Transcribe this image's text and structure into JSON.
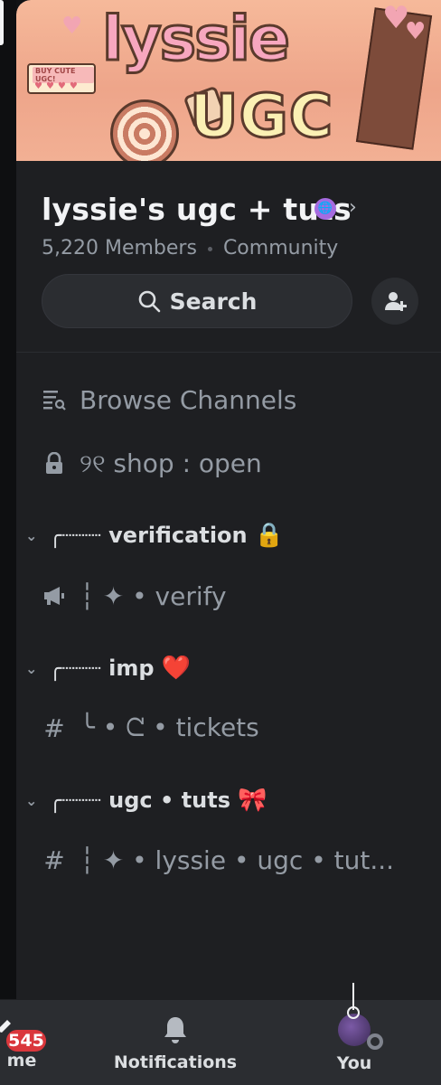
{
  "banner": {
    "title": "lyssie",
    "subtitle": "UGC",
    "tag": "BUY CUTE UGC!"
  },
  "server": {
    "name": "lyssie's ugc + tuts",
    "members": "5,220 Members",
    "type": "Community"
  },
  "search": {
    "label": "Search"
  },
  "channels": {
    "browse": "Browse Channels",
    "shop": "୨୧ shop : open",
    "categories": [
      {
        "label": "╭┈┈┈ verification",
        "emoji": "🔒",
        "channel_icon": "announcement-icon",
        "channel": "┆ ✦ • verify"
      },
      {
        "label": "╭┈┈┈ imp",
        "emoji": "❤️",
        "channel_icon": "hash-icon",
        "channel": "╰ • ᘧ • tickets"
      },
      {
        "label": "╭┈┈┈ ugc • tuts",
        "emoji": "🎀",
        "channel_icon": "hash-icon",
        "channel": "┆ ✦ • lyssie • ugc • tut..."
      }
    ]
  },
  "bottom_nav": {
    "home_label": "me",
    "home_badge": "545",
    "notifications_label": "Notifications",
    "you_label": "You"
  },
  "colors": {
    "background": "#1e1f22",
    "nav_background": "#2b2d31",
    "badge": "#da373c",
    "verified_badge": "#a56be0"
  }
}
